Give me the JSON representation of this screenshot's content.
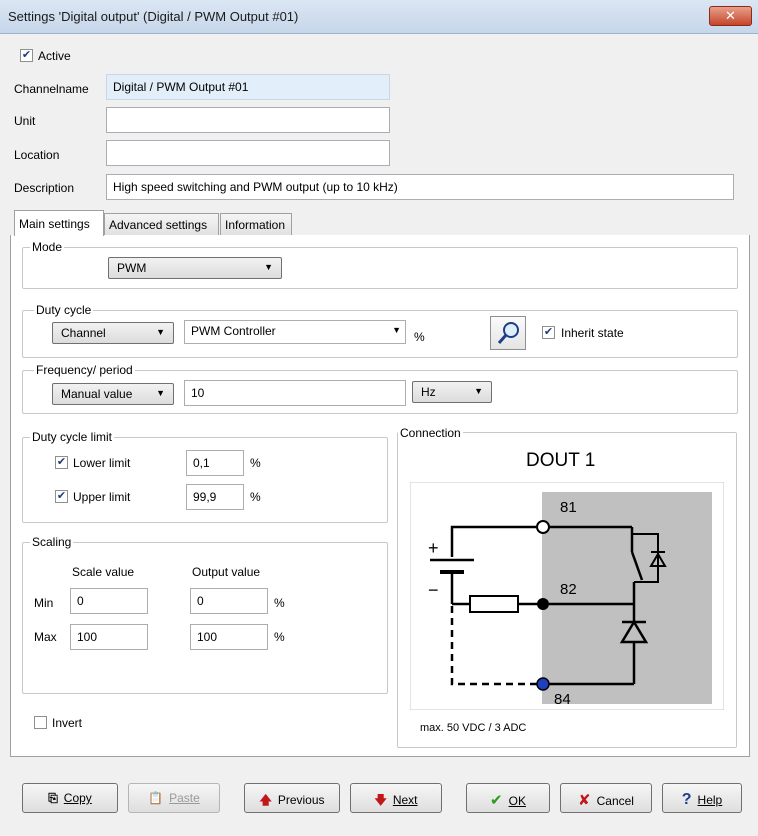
{
  "window": {
    "title": "Settings 'Digital output' (Digital / PWM Output #01)",
    "close_label": "✕"
  },
  "header": {
    "active_label": "Active",
    "channelname_label": "Channelname",
    "channelname_value": "Digital / PWM Output #01",
    "unit_label": "Unit",
    "unit_value": "",
    "location_label": "Location",
    "location_value": "",
    "description_label": "Description",
    "description_value": "High speed switching and PWM output (up to 10 kHz)"
  },
  "tabs": [
    {
      "label": "Main settings"
    },
    {
      "label": "Advanced settings"
    },
    {
      "label": "Information"
    }
  ],
  "mode": {
    "group_label": "Mode",
    "value": "PWM"
  },
  "duty_cycle": {
    "group_label": "Duty cycle",
    "source": "Channel",
    "channel": "PWM Controller",
    "unit": "%",
    "inherit_label": "Inherit state"
  },
  "frequency": {
    "group_label": "Frequency/ period",
    "source": "Manual value",
    "value": "10",
    "unit": "Hz"
  },
  "duty_limit": {
    "group_label": "Duty cycle limit",
    "lower_label": "Lower limit",
    "lower_value": "0,1",
    "upper_label": "Upper limit",
    "upper_value": "99,9",
    "unit": "%"
  },
  "scaling": {
    "group_label": "Scaling",
    "scale_header": "Scale value",
    "output_header": "Output value",
    "min_label": "Min",
    "min_scale": "0",
    "min_output": "0",
    "max_label": "Max",
    "max_scale": "100",
    "max_output": "100",
    "unit": "%"
  },
  "invert_label": "Invert",
  "connection": {
    "group_label": "Connection",
    "title": "DOUT 1",
    "pin1": "81",
    "pin2": "82",
    "pin3": "84",
    "plus": "+",
    "minus": "−",
    "rating": "max. 50 VDC / 3 ADC"
  },
  "buttons": {
    "copy": "Copy",
    "paste": "Paste",
    "previous": "Previous",
    "next": "Next",
    "ok": "OK",
    "cancel": "Cancel",
    "help": "Help"
  }
}
